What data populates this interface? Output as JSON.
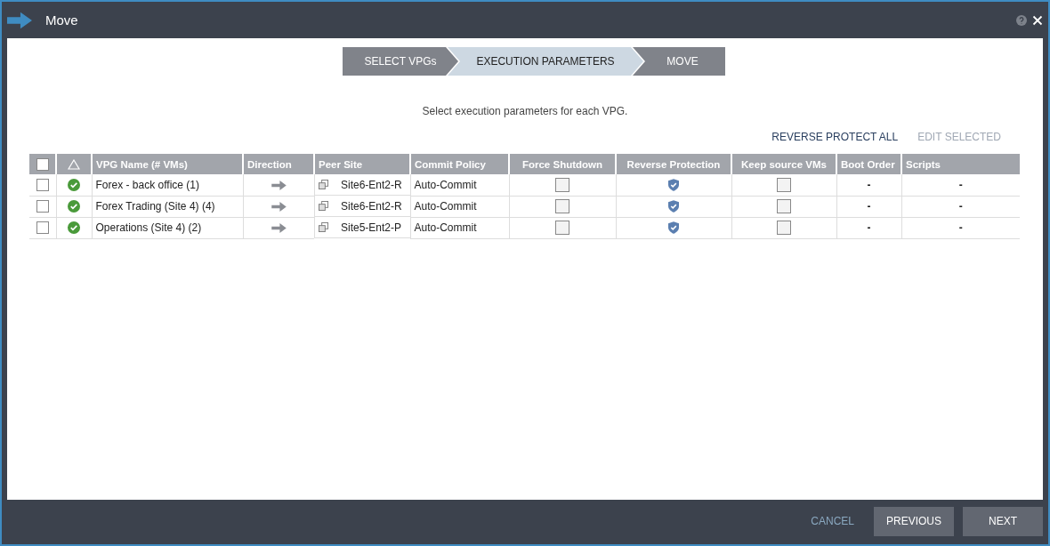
{
  "window": {
    "title": "Move"
  },
  "steps": [
    {
      "label": "SELECT VPGs",
      "selected": false
    },
    {
      "label": "EXECUTION PARAMETERS",
      "selected": true
    },
    {
      "label": "MOVE",
      "selected": false
    }
  ],
  "instruction": "Select execution parameters for each VPG.",
  "actions": [
    {
      "label": "REVERSE PROTECT ALL",
      "disabled": false
    },
    {
      "label": "EDIT SELECTED",
      "disabled": true
    }
  ],
  "table": {
    "select_all": {
      "checked": false
    },
    "columns": [
      "VPG Name (# VMs)",
      "Direction",
      "Peer Site",
      "Commit Policy",
      "Force Shutdown",
      "Reverse Protection",
      "Keep source VMs",
      "Boot Order",
      "Scripts"
    ],
    "rows": [
      {
        "checked": false,
        "healthy": true,
        "name": "Forex - back office (1)",
        "peer_site": "Site6-Ent2-R",
        "commit_policy": "Auto-Commit",
        "force_shutdown": false,
        "reverse_protection": true,
        "keep_source_vms": false,
        "boot_order": "-",
        "scripts": "-"
      },
      {
        "checked": false,
        "healthy": true,
        "name": "Forex Trading (Site 4) (4)",
        "peer_site": "Site6-Ent2-R",
        "commit_policy": "Auto-Commit",
        "force_shutdown": false,
        "reverse_protection": true,
        "keep_source_vms": false,
        "boot_order": "-",
        "scripts": "-"
      },
      {
        "checked": false,
        "healthy": true,
        "name": "Operations (Site 4) (2)",
        "peer_site": "Site5-Ent2-P",
        "commit_policy": "Auto-Commit",
        "force_shutdown": false,
        "reverse_protection": true,
        "keep_source_vms": false,
        "boot_order": "-",
        "scripts": "-"
      }
    ]
  },
  "footer": {
    "buttons": [
      {
        "label": "CANCEL",
        "kind": "link"
      },
      {
        "label": "PREVIOUS",
        "kind": "button"
      },
      {
        "label": "NEXT",
        "kind": "button"
      }
    ]
  }
}
